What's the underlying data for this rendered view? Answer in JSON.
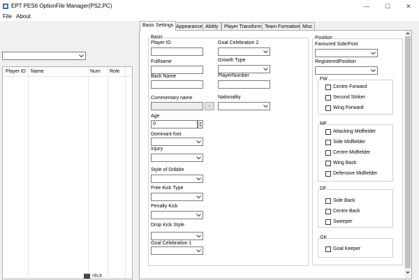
{
  "window": {
    "title": "EPT PES6 OptionFile Manager(PS2,PC)",
    "minimize": "—",
    "maximize": "☐",
    "close": "✕"
  },
  "menu": {
    "file": "File",
    "about": "About"
  },
  "left": {
    "columns": [
      "Player ID",
      "Name",
      "Num",
      "Role"
    ],
    "taskbar_text": "ᵃ6tJt"
  },
  "tabs": [
    "Basic Settings",
    "Appearance",
    "Ability",
    "Player Transform",
    "Team Formation",
    "Misc"
  ],
  "basic": {
    "group_label": "Basic",
    "player_id": "Player ID",
    "full_name": "FullName",
    "back_name": "Back Name",
    "commentary_name": "Commentary name",
    "commentary_button": "...",
    "age": "Age",
    "age_value": "0",
    "dominant_foot": "Dominant foot",
    "injury": "Injury",
    "style_of_dribble": "Style of Dribble",
    "free_kick_type": "Free Kick Type",
    "penalty_kick": "Penalty Kick",
    "drop_kick_style": "Drop Kick Style",
    "goal_celebration_1": "Goal Celebration 1",
    "goal_celebration_2": "Goal Celebration 2",
    "growth_type": "Growth Type",
    "player_number": "PlayerNumber",
    "nationality": "Nationality"
  },
  "position": {
    "group_label": "Position",
    "favoured": "Favoured Side/Foot",
    "registered": "RegisteredPosition",
    "fw_label": "FW",
    "fw": [
      "Centre Forward",
      "Second Striker",
      "Wing Forward"
    ],
    "mf_label": "MF",
    "mf": [
      "Attacking Midfielder",
      "Side Midfielder",
      "Centre Midfielder",
      "Wing Back",
      "Defensive Midfielder"
    ],
    "df_label": "DF",
    "df": [
      "Side Back",
      "Centre Back",
      "Sweeper"
    ],
    "gk_label": "GK",
    "gk": [
      "Goal Keeper"
    ]
  }
}
